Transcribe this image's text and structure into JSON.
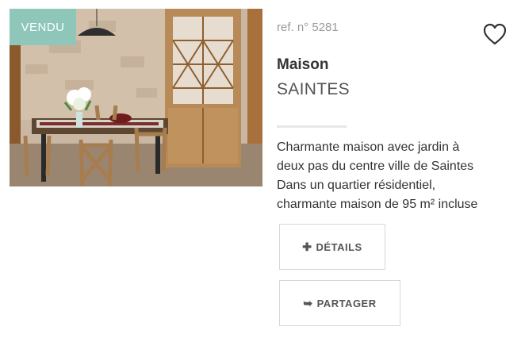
{
  "listing": {
    "status_badge": "VENDU",
    "reference": "ref. n° 5281",
    "type": "Maison",
    "city": "SAINTES",
    "description_lines": [
      "Charmante maison avec jardin à",
      "deux pas du centre ville de Saintes",
      "Dans un quartier résidentiel,",
      "charmante maison de 95 m² incluse"
    ],
    "favorite_icon": "heart-outline-icon",
    "photo": "dining-room-photo"
  },
  "actions": {
    "details_label": "DÉTAILS",
    "details_icon": "plus-icon",
    "share_label": "PARTAGER",
    "share_icon": "arrow-right-icon"
  },
  "colors": {
    "badge_bg": "#8ec6b9",
    "text": "#333333",
    "muted": "#9a9a9a",
    "border": "#d7d7d7"
  }
}
